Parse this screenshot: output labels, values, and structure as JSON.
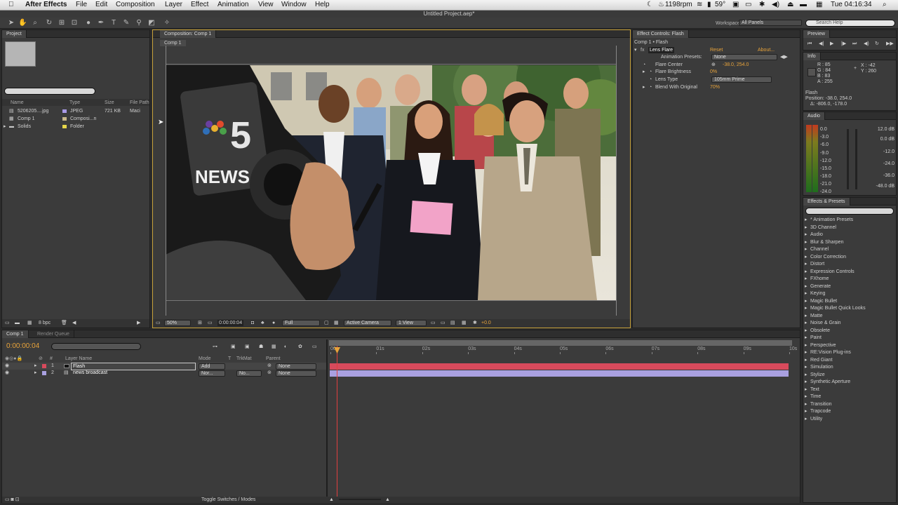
{
  "menubar": {
    "app": "After Effects",
    "items": [
      "File",
      "Edit",
      "Composition",
      "Layer",
      "Effect",
      "Animation",
      "View",
      "Window",
      "Help"
    ],
    "status": {
      "rpm": "1198rpm",
      "temp": "59°",
      "clock": "Tue 04:16:34"
    }
  },
  "window_title": "Untitled Project.aep*",
  "workspace": {
    "label": "Workspace:",
    "value": "All Panels",
    "search_placeholder": "Search Help"
  },
  "project": {
    "tab": "Project",
    "headers": {
      "name": "Name",
      "type": "Type",
      "size": "Size",
      "path": "File Path"
    },
    "items": [
      {
        "name": "5206205....jpg",
        "type": "JPEG",
        "size": "721 KB",
        "path": "Maci"
      },
      {
        "name": "Comp 1",
        "type": "Composi...n",
        "size": "",
        "path": ""
      },
      {
        "name": "Solids",
        "type": "Folder",
        "size": "",
        "path": ""
      }
    ],
    "footer": {
      "bpc": "8 bpc"
    }
  },
  "composition": {
    "tab": "Composition: Comp 1",
    "breadcrumb": "Comp 1",
    "footer": {
      "zoom": "50%",
      "timecode": "0:00:00:04",
      "resolution": "Full",
      "camera": "Active Camera",
      "view": "1 View",
      "exposure": "+0.0"
    },
    "news_logo": {
      "number": "5",
      "text": "NEWS"
    }
  },
  "effect_controls": {
    "tab": "Effect Controls: Flash",
    "path": "Comp 1 • Flash",
    "effect": "Lens Flare",
    "reset": "Reset",
    "about": "About...",
    "anim_presets_label": "Animation Presets:",
    "anim_presets_value": "None",
    "props": [
      {
        "label": "Flare Center",
        "value": "-38.0, 254.0"
      },
      {
        "label": "Flare Brightness",
        "value": "0%"
      },
      {
        "label": "Lens Type",
        "value": "105mm Prime"
      },
      {
        "label": "Blend With Original",
        "value": "70%"
      }
    ]
  },
  "preview": {
    "tab": "Preview"
  },
  "info": {
    "tab": "Info",
    "r": "R : 85",
    "g": "G : 84",
    "b": "B : 83",
    "a": "A : 255",
    "x": "X : -42",
    "y": "Y : 260",
    "layer": "Flash",
    "position": "Position: -38.0, 254.0",
    "delta": "Δ: -806.0, -178.0"
  },
  "audio": {
    "tab": "Audio",
    "left": [
      "0.0",
      "-3.0",
      "-6.0",
      "-9.0",
      "-12.0",
      "-15.0",
      "-18.0",
      "-21.0",
      "-24.0"
    ],
    "right": [
      "12.0 dB",
      "0.0 dB",
      "-12.0",
      "-24.0",
      "-36.0",
      "-48.0 dB"
    ]
  },
  "effects_presets": {
    "tab": "Effects & Presets",
    "items": [
      "* Animation Presets",
      "3D Channel",
      "Audio",
      "Blur & Sharpen",
      "Channel",
      "Color Correction",
      "Distort",
      "Expression Controls",
      "FXhome",
      "Generate",
      "Keying",
      "Magic Bullet",
      "Magic Bullet Quick Looks",
      "Matte",
      "Noise & Grain",
      "Obsolete",
      "Paint",
      "Perspective",
      "RE:Vision Plug-ins",
      "Red Giant",
      "Simulation",
      "Stylize",
      "Synthetic Aperture",
      "Text",
      "Time",
      "Transition",
      "Trapcode",
      "Utility"
    ]
  },
  "timeline": {
    "tab": "Comp 1",
    "tab2": "Render Queue",
    "timecode": "0:00:00:04",
    "headers": {
      "num": "#",
      "layer_name": "Layer Name",
      "mode": "Mode",
      "t": "T",
      "trkmat": "TrkMat",
      "parent": "Parent"
    },
    "ruler": [
      "00s",
      "01s",
      "02s",
      "03s",
      "04s",
      "05s",
      "06s",
      "07s",
      "08s",
      "09s",
      "10s"
    ],
    "layers": [
      {
        "num": "1",
        "name": "Flash",
        "mode": "Add",
        "trkmat": "",
        "parent": "None",
        "color": "#d84a5c"
      },
      {
        "num": "2",
        "name": "news broadcast",
        "mode": "Nor...",
        "trkmat": "No...",
        "parent": "None",
        "color": "#a9a0e0"
      }
    ],
    "footer": "Toggle Switches / Modes"
  },
  "colors": {
    "accent": "#e8a33b",
    "bar_flash": "#d84a5c",
    "bar_news": "#a9a0e0"
  }
}
